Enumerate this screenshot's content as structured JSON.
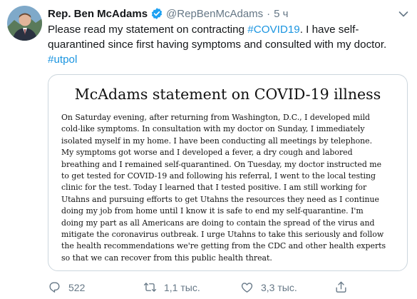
{
  "tweet": {
    "author_name": "Rep. Ben McAdams",
    "handle": "@RepBenMcAdams",
    "separator": "·",
    "time": "5 ч",
    "text_before": "Please read my statement on contracting ",
    "hashtag_covid": "#COVID19",
    "text_after": ". I have self-quarantined since first having symptoms and consulted with my doctor. ",
    "hashtag_utpol": "#utpol"
  },
  "statement": {
    "title": "McAdams statement on COVID-19 illness",
    "lines": [
      "On Saturday evening, after returning from Washington, D.C., I developed mild",
      "cold-like symptoms. In consultation with my doctor on Sunday, I immediately",
      "isolated myself in my home. I have been conducting all meetings by telephone.",
      "My symptoms got worse and I developed a fever, a dry cough and labored",
      "breathing and I remained self-quarantined. On Tuesday, my doctor instructed me",
      "to get tested for COVID-19 and following his referral, I went to the local testing",
      "clinic for the test. Today I learned that I tested positive.  I am still working for",
      "Utahns and pursuing efforts to get Utahns the resources they need as I continue",
      "doing my job from home until I know it is safe to end my self-quarantine. I'm",
      "doing my part as all Americans are doing to contain the spread of the virus and",
      "mitigate the coronavirus outbreak. I urge Utahns to take this seriously and follow",
      "the health recommendations we're getting from the CDC and other health experts",
      "so that we can recover from this public health threat."
    ]
  },
  "actions": {
    "replies": "522",
    "retweets": "1,1 тыс.",
    "likes": "3,3 тыс."
  },
  "colors": {
    "link": "#1b95e0",
    "muted": "#657786",
    "verified": "#1da1f2"
  },
  "icons": [
    "verified-badge-icon",
    "chevron-down-icon",
    "reply-icon",
    "retweet-icon",
    "like-icon",
    "share-icon"
  ]
}
